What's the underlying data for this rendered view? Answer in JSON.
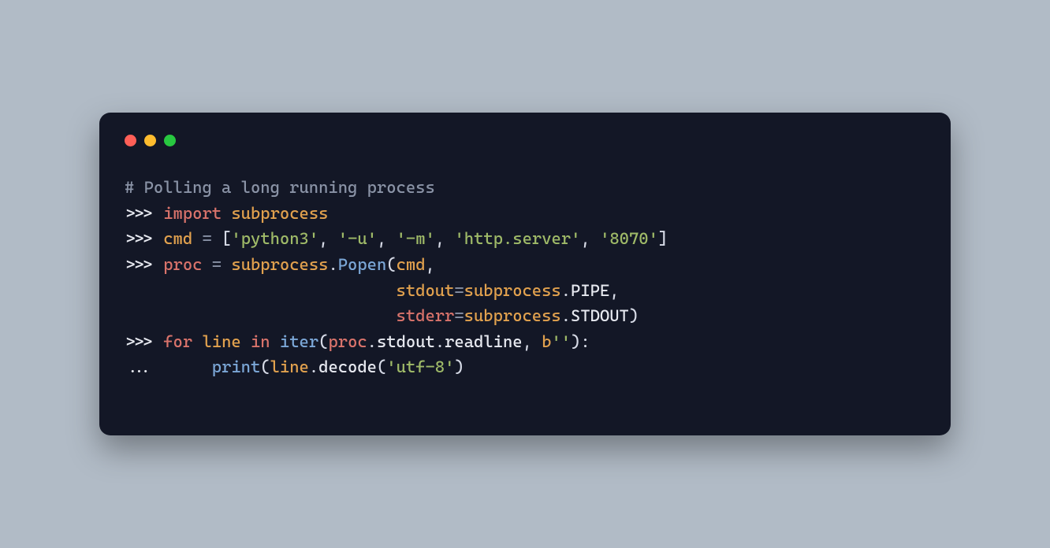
{
  "window": {
    "traffic_light": {
      "red": "#ff5f57",
      "yellow": "#febc2e",
      "green": "#28c840"
    }
  },
  "code": {
    "comment": "# Polling a long running process",
    "prompt": ">>>",
    "cont": "...",
    "kw_import": "import",
    "mod_subprocess": "subprocess",
    "var_cmd": "cmd",
    "eq": "=",
    "lbrack": "[",
    "rbrack": "]",
    "str_python3": "'python3'",
    "str_u": "'-u'",
    "str_m": "'-m'",
    "str_httpserver": "'http.server'",
    "str_port": "'8070'",
    "comma": ",",
    "var_proc": "proc",
    "dot": ".",
    "fn_popen": "Popen",
    "lp": "(",
    "rp": ")",
    "indent_args": "                            ",
    "kw_stdout": "stdout",
    "const_pipe": "PIPE",
    "kw_stderr": "stderr",
    "const_stdout": "STDOUT",
    "kw_for": "for",
    "var_line": "line",
    "kw_in": "in",
    "fn_iter": "iter",
    "attr_stdout": "stdout",
    "attr_readline": "readline",
    "b_prefix": "b",
    "str_empty": "''",
    "colon": ":",
    "indent_body": "     ",
    "fn_print": "print",
    "attr_decode": "decode",
    "str_utf8": "'utf-8'"
  }
}
